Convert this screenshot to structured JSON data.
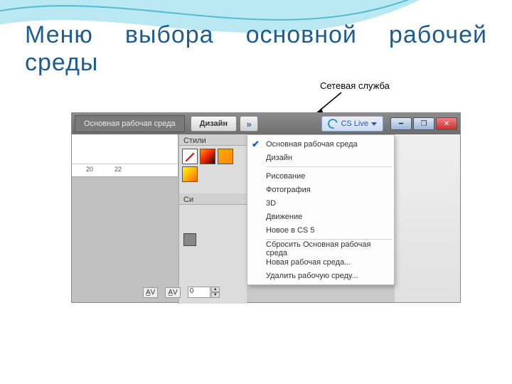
{
  "slide": {
    "title": "Меню выбора основной рабочей среды"
  },
  "callout": {
    "label": "Сетевая служба"
  },
  "topbar": {
    "workspace_current": "Основная рабочая среда",
    "tab_label": "Дизайн",
    "cslive_label": "CS Live"
  },
  "window_controls": {
    "minimize": "━",
    "maximize": "❐",
    "close": "✕"
  },
  "dropdown": {
    "items": [
      {
        "label": "Основная рабочая среда",
        "checked": true
      },
      {
        "label": "Дизайн",
        "checked": false
      },
      {
        "label": "Рисование",
        "checked": false
      },
      {
        "label": "Фотография",
        "checked": false
      },
      {
        "label": "3D",
        "checked": false
      },
      {
        "label": "Движение",
        "checked": false
      },
      {
        "label": "Новое в CS 5",
        "checked": false
      }
    ],
    "footer": [
      "Сбросить Основная рабочая среда",
      "Новая рабочая среда...",
      "Удалить рабочую среду..."
    ]
  },
  "panels": {
    "styles_title": "Стили",
    "side_title": "Си"
  },
  "ruler": {
    "t1": "20",
    "t2": "22"
  },
  "bottombar": {
    "kerning_icon1": "A̲V",
    "kerning_icon2": "A̲V",
    "value": "0"
  },
  "colors": {
    "title": "#1f5d8f",
    "accent": "#2a6fb0"
  }
}
